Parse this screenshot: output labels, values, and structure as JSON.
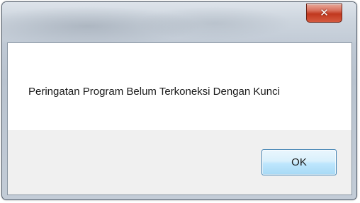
{
  "window": {
    "title": "",
    "close_icon": "close-icon"
  },
  "dialog": {
    "message": "Peringatan Program Belum Terkoneksi Dengan Kunci",
    "ok_label": "OK"
  },
  "colors": {
    "close_button": "#c1381f",
    "ok_button_border": "#3c7fb1"
  }
}
